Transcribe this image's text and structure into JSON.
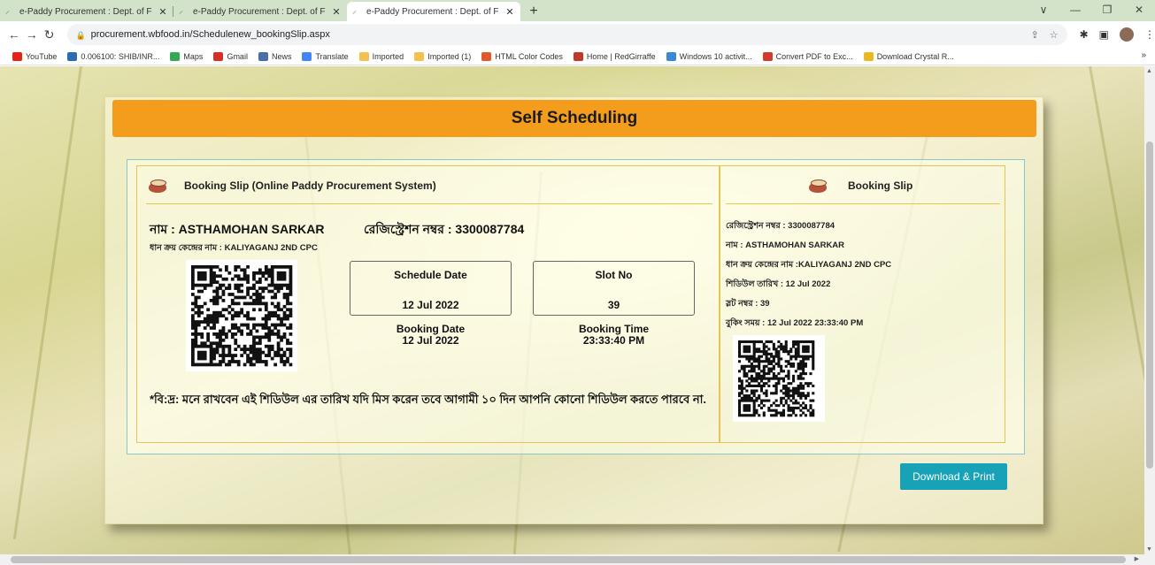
{
  "browser": {
    "tabs": [
      {
        "title": "e-Paddy Procurement : Dept. of F",
        "active": false
      },
      {
        "title": "e-Paddy Procurement : Dept. of F",
        "active": false
      },
      {
        "title": "e-Paddy Procurement : Dept. of F",
        "active": true
      }
    ],
    "new_tab": "+",
    "window_controls": {
      "chevron": "∨",
      "minimize": "—",
      "restore": "❐",
      "close": "✕"
    },
    "url": "procurement.wbfood.in/Schedulenew_bookingSlip.aspx",
    "bookmarks": [
      {
        "label": "YouTube",
        "icon": "youtube-icon",
        "color": "#e62117"
      },
      {
        "label": "0.006100: SHIB/INR...",
        "icon": "chart-icon",
        "color": "#2b6cb0"
      },
      {
        "label": "Maps",
        "icon": "maps-icon",
        "color": "#34a853"
      },
      {
        "label": "Gmail",
        "icon": "gmail-icon",
        "color": "#d93025"
      },
      {
        "label": "News",
        "icon": "news-icon",
        "color": "#4a6fa5"
      },
      {
        "label": "Translate",
        "icon": "translate-icon",
        "color": "#4285f4"
      },
      {
        "label": "Imported",
        "icon": "folder-icon",
        "color": "#f2c14e"
      },
      {
        "label": "Imported (1)",
        "icon": "folder-icon",
        "color": "#f2c14e"
      },
      {
        "label": "HTML Color Codes",
        "icon": "color-icon",
        "color": "#e2572c"
      },
      {
        "label": "Home | RedGirraffe",
        "icon": "redgirraffe-icon",
        "color": "#c0392b"
      },
      {
        "label": "Windows 10 activit...",
        "icon": "windows-icon",
        "color": "#3a88d6"
      },
      {
        "label": "Convert PDF to Exc...",
        "icon": "pdf-icon",
        "color": "#d23c2a"
      },
      {
        "label": "Download Crystal R...",
        "icon": "tek-icon",
        "color": "#e9b923"
      }
    ],
    "bookmarks_more": "»"
  },
  "page": {
    "header": "Self Scheduling",
    "slip": {
      "title": "Booking Slip (Online Paddy Procurement System)",
      "name_line": "নাম : ASTHAMOHAN SARKAR",
      "reg_line": "রেজিস্ট্রেশন নম্বর : 3300087784",
      "cpc_line": "ধান ক্রয় কেন্দ্রের নাম : KALIYAGANJ 2ND CPC",
      "schedule_date_label": "Schedule Date",
      "schedule_date": "12 Jul 2022",
      "slot_label": "Slot No",
      "slot_no": "39",
      "booking_date_label": "Booking Date",
      "booking_date": "12 Jul 2022",
      "booking_time_label": "Booking Time",
      "booking_time": "23:33:40 PM",
      "note": "*বি:দ্র: মনে রাখবেন এই শিডিউল এর তারিখ যদি মিস করেন তবে আগামী ১০ দিন আপনি কোনো শিডিউল করতে পারবে না."
    },
    "stub": {
      "title": "Booking Slip",
      "lines": [
        "রেজিস্ট্রেশন নম্বর : 3300087784",
        "নাম : ASTHAMOHAN SARKAR",
        "ধান ক্রয় কেন্দ্রের নাম :KALIYAGANJ 2ND CPC",
        "শিডিউল তারিখ : 12 Jul 2022",
        "স্লট নম্বর : 39",
        "বুকিং সময় : 12 Jul 2022 23:33:40 PM"
      ]
    },
    "download_button": "Download & Print"
  },
  "colors": {
    "header": "#f49c1c",
    "button": "#17a2b8",
    "border": "#e5c653"
  }
}
